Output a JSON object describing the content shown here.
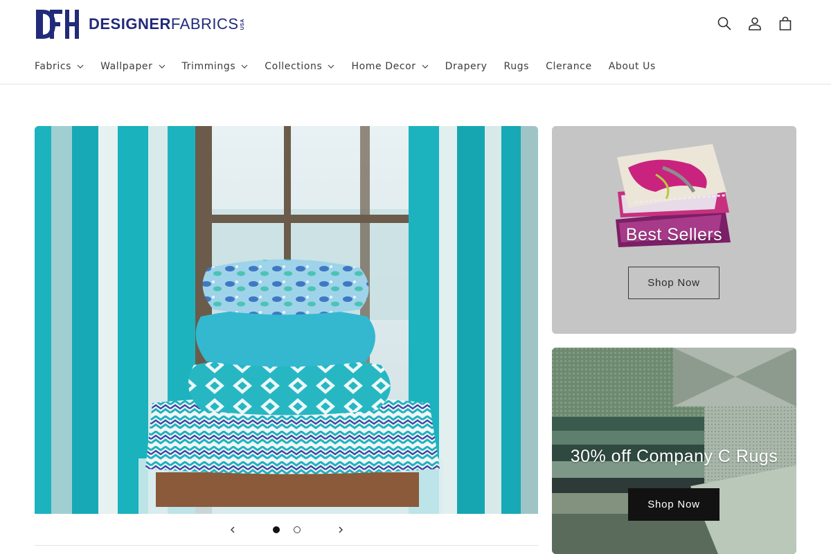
{
  "brand": {
    "logo_primary": "DESIGNER",
    "logo_secondary": "FABRICS",
    "logo_suffix": "USA",
    "color": "#222a7a"
  },
  "header_icons": [
    "search-icon",
    "account-icon",
    "cart-icon"
  ],
  "nav": {
    "items": [
      {
        "label": "Fabrics",
        "dropdown": true
      },
      {
        "label": "Wallpaper",
        "dropdown": true
      },
      {
        "label": "Trimmings",
        "dropdown": true
      },
      {
        "label": "Collections",
        "dropdown": true
      },
      {
        "label": "Home Decor",
        "dropdown": true
      },
      {
        "label": "Drapery",
        "dropdown": false
      },
      {
        "label": "Rugs",
        "dropdown": false
      },
      {
        "label": "Clerance",
        "dropdown": false
      },
      {
        "label": "About Us",
        "dropdown": false
      }
    ]
  },
  "slideshow": {
    "slide_count": 2,
    "active_slide": 1,
    "image_description_icon": "pillows-on-bench-image"
  },
  "promos": [
    {
      "title": "Best Sellers",
      "button_label": "Shop Now",
      "button_style": "outline"
    },
    {
      "title": "30% off Company C Rugs",
      "button_label": "Shop Now",
      "button_style": "solid"
    }
  ],
  "colors": {
    "accent": "#121212",
    "card_gray": "#c5c5c5",
    "teal": "#1fb5bf"
  }
}
